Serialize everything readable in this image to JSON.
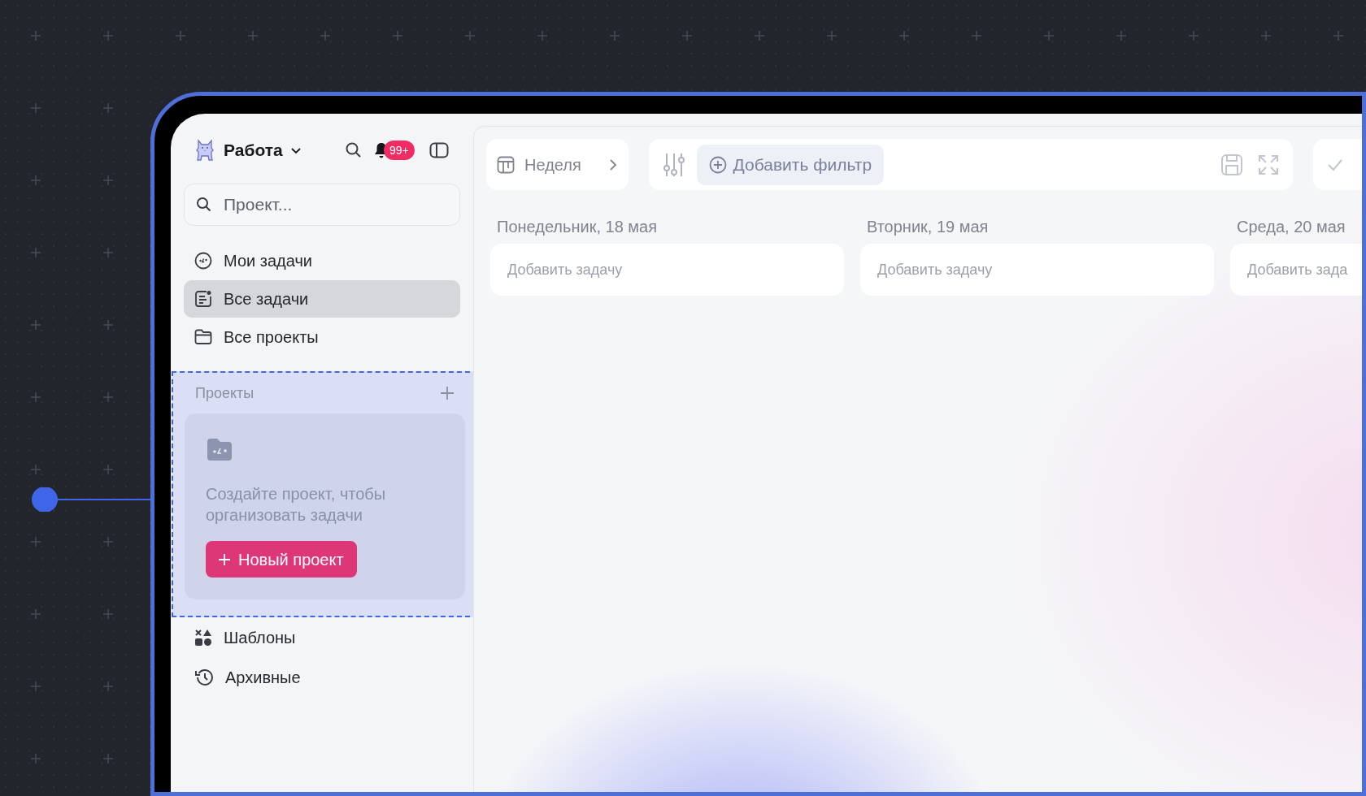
{
  "workspace": {
    "name": "Работа"
  },
  "notifications": {
    "badge": "99+"
  },
  "search": {
    "placeholder": "Проект..."
  },
  "nav": [
    {
      "label": "Мои задачи",
      "selected": false
    },
    {
      "label": "Все задачи",
      "selected": true
    },
    {
      "label": "Все проекты",
      "selected": false
    }
  ],
  "projects_section": {
    "title": "Проекты",
    "empty_message": "Создайте проект, чтобы организовать задачи",
    "button": "Новый проект"
  },
  "bottom_nav": [
    {
      "label": "Шаблоны"
    },
    {
      "label": "Архивные"
    }
  ],
  "toolbar": {
    "view": "Неделя",
    "filter_button": "Добавить фильтр"
  },
  "days": [
    {
      "title": "Понедельник, 18 мая",
      "placeholder": "Добавить задачу"
    },
    {
      "title": "Вторник, 19 мая",
      "placeholder": "Добавить задачу"
    },
    {
      "title": "Среда, 20 мая",
      "placeholder": "Добавить зада"
    }
  ]
}
